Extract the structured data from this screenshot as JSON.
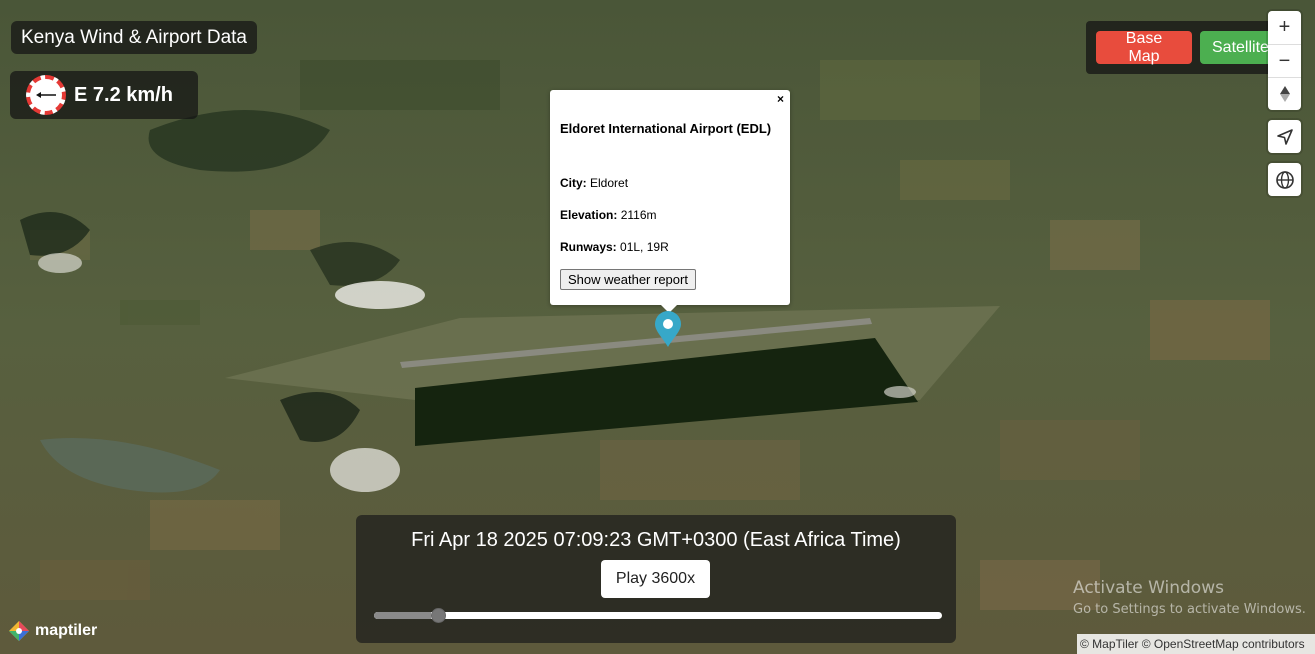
{
  "app": {
    "title": "Kenya Wind & Airport Data"
  },
  "wind": {
    "direction": "E",
    "speed_text": "E 7.2 km/h",
    "dial_color": "#e53935"
  },
  "map_style": {
    "options": [
      "Base Map",
      "Satellite"
    ],
    "base_label": "Base Map",
    "satellite_label": "Satellite",
    "base_color": "#e84c3d",
    "satellite_color": "#4caf50"
  },
  "controls": {
    "zoom_in": "+",
    "zoom_out": "−",
    "compass": "compass-icon",
    "geolocate": "navigation-arrow-icon",
    "globe": "globe-icon"
  },
  "popup": {
    "close": "×",
    "title": "Eldoret International Airport (EDL)",
    "city_label": "City:",
    "city_value": "Eldoret",
    "elevation_label": "Elevation:",
    "elevation_value": "2116m",
    "runways_label": "Runways:",
    "runways_value": "01L, 19R",
    "weather_button": "Show weather report"
  },
  "marker": {
    "color": "#37a8c8",
    "icon": "map-pin-icon"
  },
  "timeline": {
    "datetime": "Fri Apr 18 2025 07:09:23 GMT+0300 (East Africa Time)",
    "play_label": "Play 3600x",
    "progress": 0.1
  },
  "logo": {
    "name": "maptiler"
  },
  "watermark": {
    "title": "Activate Windows",
    "subtitle": "Go to Settings to activate Windows."
  },
  "attribution": "© MapTiler © OpenStreetMap contributors"
}
